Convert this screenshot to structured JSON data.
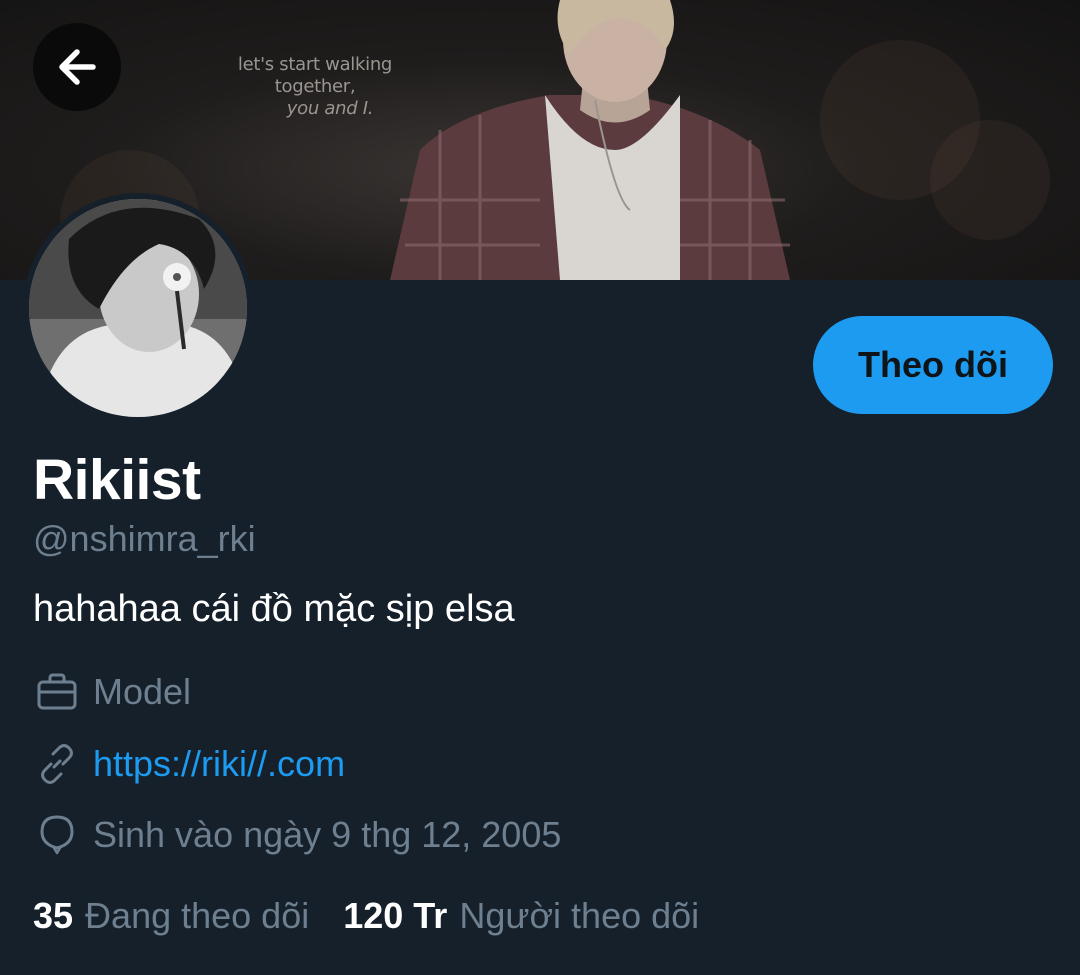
{
  "header": {
    "back_icon": "arrow-left-icon",
    "banner_quote_line1": "let's start walking together,",
    "banner_quote_line2": "you and I."
  },
  "profile": {
    "display_name": "Rikiist",
    "handle": "@nshimra_rki",
    "bio": "hahahaa cái đồ mặc sịp elsa",
    "follow_label": "Theo dõi",
    "job": "Model",
    "job_icon": "briefcase-icon",
    "url": "https://riki//.com",
    "url_icon": "link-icon",
    "birthday": "Sinh vào ngày 9 thg 12, 2005",
    "birthday_icon": "balloon-icon"
  },
  "stats": {
    "following_count": "35",
    "following_label": "Đang theo dõi",
    "followers_count": "120 Tr",
    "followers_label": "Người theo dõi"
  },
  "colors": {
    "background": "#15202b",
    "accent": "#1d9bf0",
    "secondary_text": "#6e7f8f",
    "primary_text": "#ffffff"
  }
}
